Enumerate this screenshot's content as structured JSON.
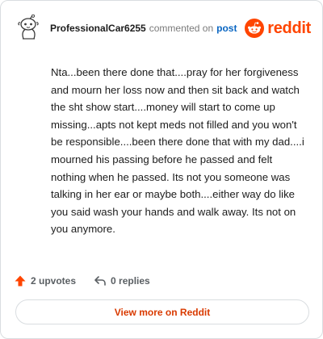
{
  "header": {
    "username": "ProfessionalCar6255",
    "action_text": "commented on",
    "post_link": "post",
    "brand": "reddit"
  },
  "comment": {
    "text": "Nta...been there done that....pray for her forgiveness and mourn her loss now and then sit back and watch the sht show start....money will start to come up missing...apts not kept meds not filled and you won't be responsible....been there done that with my dad....i mourned his passing before he passed and felt nothing when he passed. Its not you someone was talking in her ear or maybe both....either way do like you said wash your hands and walk away. Its not on you anymore."
  },
  "actions": {
    "upvotes": "2 upvotes",
    "replies": "0 replies"
  },
  "footer": {
    "view_more": "View more on Reddit"
  },
  "colors": {
    "brand": "#ff4500",
    "link": "#0a66c2",
    "view_more": "#d93a00"
  },
  "icons": {
    "avatar": "snoo-avatar-icon",
    "brand": "reddit-logo-icon",
    "upvote": "upvote-arrow-icon",
    "reply": "reply-arrow-icon"
  }
}
